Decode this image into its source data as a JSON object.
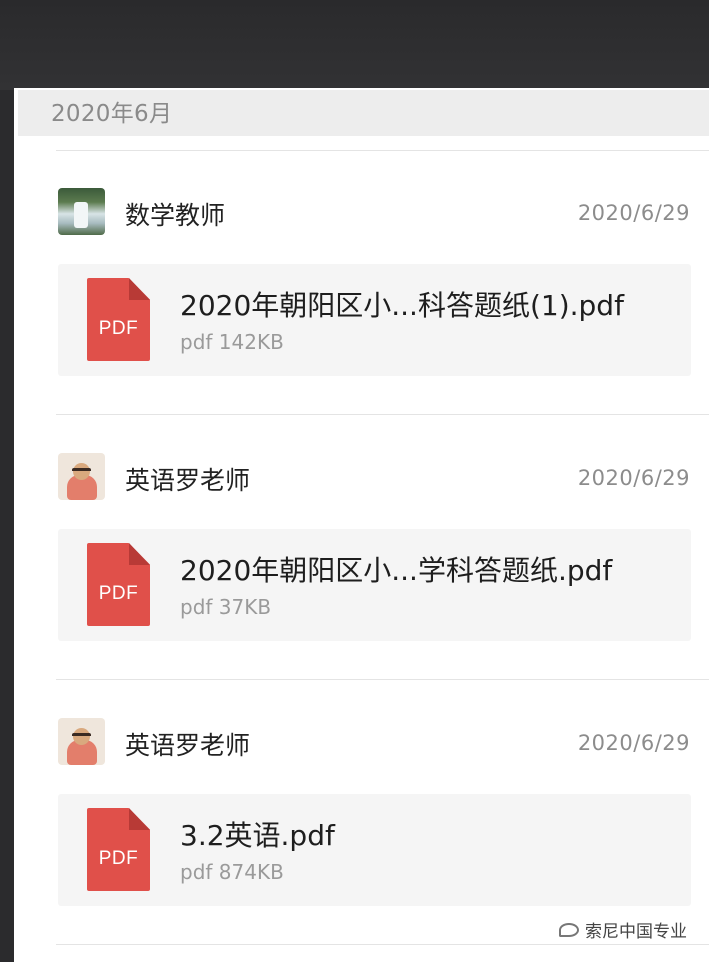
{
  "month_header": "2020年6月",
  "messages": [
    {
      "sender": "数学教师",
      "date": "2020/6/29",
      "avatar": "waterfall-avatar",
      "file": {
        "icon_label": "PDF",
        "name": "2020年朝阳区小...科答题纸(1).pdf",
        "meta": "pdf 142KB"
      }
    },
    {
      "sender": "英语罗老师",
      "date": "2020/6/29",
      "avatar": "teacher-avatar",
      "file": {
        "icon_label": "PDF",
        "name": "2020年朝阳区小...学科答题纸.pdf",
        "meta": "pdf 37KB"
      }
    },
    {
      "sender": "英语罗老师",
      "date": "2020/6/29",
      "avatar": "teacher-avatar",
      "file": {
        "icon_label": "PDF",
        "name": "3.2英语.pdf",
        "meta": "pdf 874KB"
      }
    }
  ],
  "watermark": "索尼中国专业",
  "colors": {
    "pdf_red": "#e0504a",
    "header_bg": "#ededed",
    "card_bg": "#f5f5f5"
  }
}
